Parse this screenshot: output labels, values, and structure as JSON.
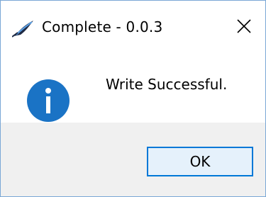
{
  "window": {
    "title": "Complete - 0.0.3",
    "app_icon": "feather-quill-icon",
    "close_icon": "close-icon"
  },
  "dialog": {
    "icon": "info-icon",
    "message": "Write Successful."
  },
  "buttons": {
    "ok_label": "OK"
  },
  "colors": {
    "accent": "#0078d7",
    "info_icon": "#1a73c5",
    "footer_bg": "#f0f0f0",
    "button_bg": "#e5f1fb"
  }
}
